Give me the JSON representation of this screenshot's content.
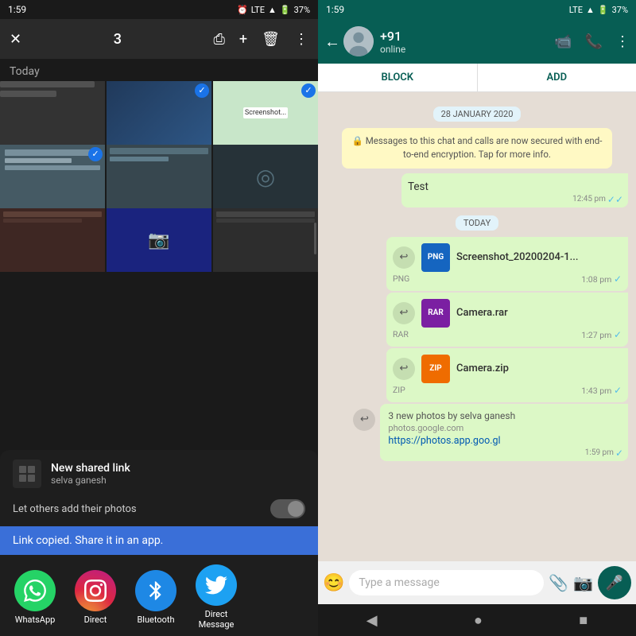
{
  "left": {
    "status_bar": {
      "time": "1:59",
      "alarm_icon": "alarm",
      "lte": "LTE",
      "battery": "37%"
    },
    "toolbar": {
      "close_label": "✕",
      "selected_count": "3",
      "share_icon": "share",
      "add_icon": "+",
      "delete_icon": "🗑",
      "more_icon": "⋮"
    },
    "section_label": "Today",
    "share_sheet": {
      "title": "New shared link",
      "subtitle": "selva ganesh",
      "let_others_text": "Let others add their photos",
      "link_copied_text": "Link copied. Share it in an app.",
      "apps": [
        {
          "name": "WhatsApp",
          "icon_type": "whatsapp",
          "label": "WhatsApp"
        },
        {
          "name": "Direct",
          "icon_type": "instagram",
          "label": "Direct"
        },
        {
          "name": "Bluetooth",
          "icon_type": "bluetooth",
          "label": "Bluetooth"
        },
        {
          "name": "Direct Message",
          "icon_type": "twitter",
          "label": "Direct\nMessage"
        }
      ]
    },
    "nav": {
      "back": "◀",
      "home": "●",
      "recents": "■"
    }
  },
  "right": {
    "status_bar": {
      "time": "1:59",
      "lte": "LTE",
      "battery": "37%"
    },
    "header": {
      "contact_name": "+91",
      "contact_status": "online",
      "back_arrow": "←",
      "video_call_icon": "📹",
      "call_icon": "📞",
      "more_icon": "⋮"
    },
    "tabs": {
      "block_label": "BLOCK",
      "add_label": "ADD"
    },
    "messages": {
      "date_jan": "28 JANUARY 2020",
      "encryption_notice": "Messages to this chat and calls are now secured with end-to-end encryption. Tap for more info.",
      "msg1": {
        "text": "Test",
        "time": "12:45 pm",
        "ticks": "✓✓"
      },
      "today_label": "TODAY",
      "file1": {
        "name": "Screenshot_20200204-1...",
        "type": "PNG",
        "time": "1:08 pm",
        "ticks": "✓"
      },
      "file2": {
        "name": "Camera.rar",
        "type": "RAR",
        "time": "1:27 pm",
        "ticks": "✓"
      },
      "file3": {
        "name": "Camera.zip",
        "type": "ZIP",
        "time": "1:43 pm",
        "ticks": "✓"
      },
      "link_msg": {
        "title": "3 new photos by selva ganesh",
        "domain": "photos.google.com",
        "url": "https://photos.app.goo.gl",
        "time": "1:59 pm",
        "ticks": "✓"
      }
    },
    "input": {
      "placeholder": "Type a message",
      "emoji_icon": "😊",
      "attach_icon": "📎",
      "camera_icon": "📷",
      "mic_icon": "🎤"
    },
    "nav": {
      "back": "◀",
      "home": "●",
      "recents": "■"
    }
  }
}
